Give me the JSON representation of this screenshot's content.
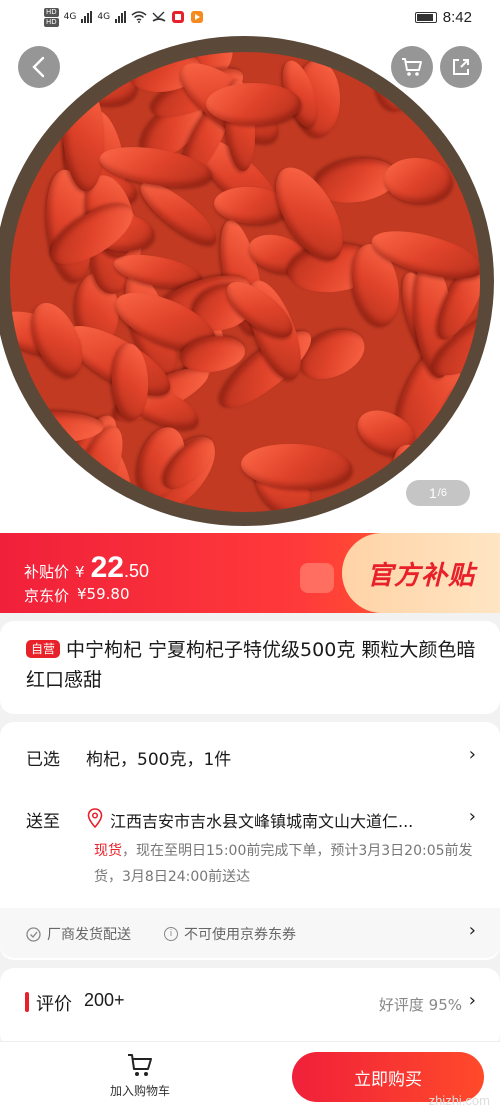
{
  "status_bar": {
    "network_label": "4G",
    "time": "8:42"
  },
  "gallery": {
    "page_current": "1",
    "page_total": "/6"
  },
  "price": {
    "subsidy_label": "补贴价",
    "subsidy_symbol": "¥",
    "subsidy_integer": "22",
    "subsidy_decimal": ".50",
    "jd_label": "京东价",
    "jd_price": "¥59.80",
    "official_badge": "官方补贴"
  },
  "product": {
    "tag": "自营",
    "title": "中宁枸杞 宁夏枸杞子特优级500克 颗粒大颜色暗红口感甜"
  },
  "options": {
    "selected_label": "已选",
    "selected_value": "枸杞，500克，1件",
    "ship_to_label": "送至",
    "address": "江西吉安市吉水县文峰镇城南文山大道仁...",
    "stock_label": "现货",
    "delivery_text": "，现在至明日15:00前完成下单，预计3月3日20:05前发货，3月8日24:00前送达"
  },
  "services": {
    "item1": "厂商发货配送",
    "item2": "不可使用京券东券"
  },
  "reviews": {
    "title": "评价",
    "count": "200+",
    "rate": "好评度 95%"
  },
  "bottom_bar": {
    "cart_label": "加入购物车",
    "buy_label": "立即购买"
  },
  "watermark": "zhizhi.com",
  "colors": {
    "accent": "#e8202a",
    "price_bar": "#f0203a",
    "badge_bg": "#ffe0bd"
  }
}
